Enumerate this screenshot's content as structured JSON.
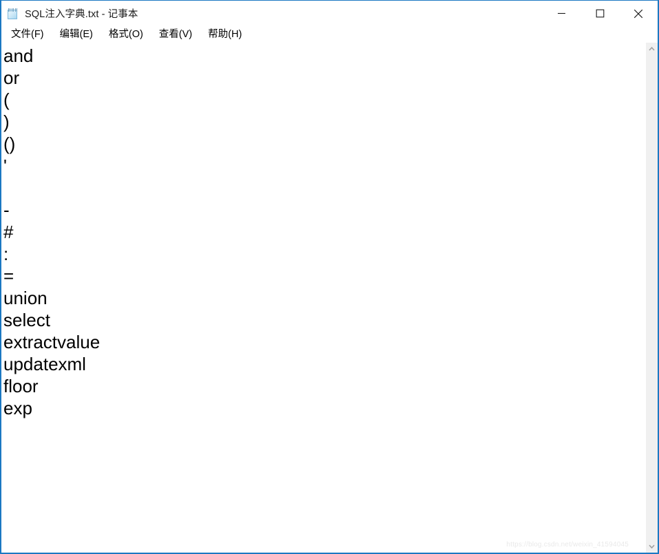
{
  "window": {
    "title": "SQL注入字典.txt - 记事本",
    "icon": "notepad-icon",
    "border_color": "#1b78c2",
    "controls": [
      {
        "name": "minimize",
        "glyph": "minimize-icon"
      },
      {
        "name": "maximize",
        "glyph": "maximize-icon"
      },
      {
        "name": "close",
        "glyph": "close-icon"
      }
    ]
  },
  "menubar": {
    "items": [
      {
        "label": "文件(F)"
      },
      {
        "label": "编辑(E)"
      },
      {
        "label": "格式(O)"
      },
      {
        "label": "查看(V)"
      },
      {
        "label": "帮助(H)"
      }
    ]
  },
  "document": {
    "lines": [
      "and",
      "or",
      "(",
      ")",
      "()",
      "'",
      "",
      "-",
      "#",
      ":",
      "=",
      "union",
      "select",
      "extractvalue",
      "updatexml",
      "floor",
      "exp"
    ]
  },
  "scrollbar": {
    "up_arrow": "chevron-up-icon",
    "down_arrow": "chevron-down-icon",
    "track_color": "#f0f0f0",
    "arrow_color": "#a0a0a0"
  },
  "watermark": {
    "text": "https://blog.csdn.net/weixin_41594045"
  }
}
